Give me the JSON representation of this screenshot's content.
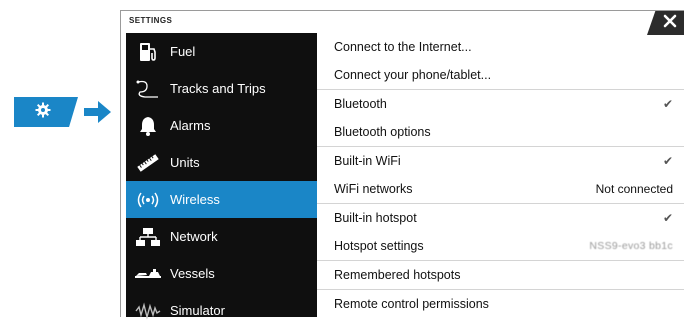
{
  "window": {
    "title": "SETTINGS",
    "close_icon": "close-icon"
  },
  "pointer": {
    "icon": "gear-icon",
    "arrow": "arrow-right-icon",
    "accent": "#1a86c7"
  },
  "sidebar": {
    "items": [
      {
        "label": "Fuel",
        "icon": "fuel-pump-icon",
        "active": false
      },
      {
        "label": "Tracks and Trips",
        "icon": "tracks-icon",
        "active": false
      },
      {
        "label": "Alarms",
        "icon": "bell-icon",
        "active": false
      },
      {
        "label": "Units",
        "icon": "ruler-icon",
        "active": false
      },
      {
        "label": "Wireless",
        "icon": "wireless-icon",
        "active": true
      },
      {
        "label": "Network",
        "icon": "network-icon",
        "active": false
      },
      {
        "label": "Vessels",
        "icon": "vessels-icon",
        "active": false
      },
      {
        "label": "Simulator",
        "icon": "simulator-icon",
        "active": false
      }
    ]
  },
  "settings": {
    "rows": [
      {
        "label": "Connect to the Internet..."
      },
      {
        "label": "Connect your phone/tablet..."
      },
      {
        "label": "Bluetooth",
        "checked": true
      },
      {
        "label": "Bluetooth options"
      },
      {
        "label": "Built-in WiFi",
        "checked": true
      },
      {
        "label": "WiFi networks",
        "value": "Not connected"
      },
      {
        "label": "Built-in hotspot",
        "checked": true
      },
      {
        "label": "Hotspot settings",
        "value": "NSS9-evo3 bb1c"
      },
      {
        "label": "Remembered hotspots"
      },
      {
        "label": "Remote control permissions"
      }
    ]
  },
  "colors": {
    "accent": "#1a86c7",
    "sidebar_bg": "#0f0f0f",
    "close_bg": "#2c2c2c"
  }
}
